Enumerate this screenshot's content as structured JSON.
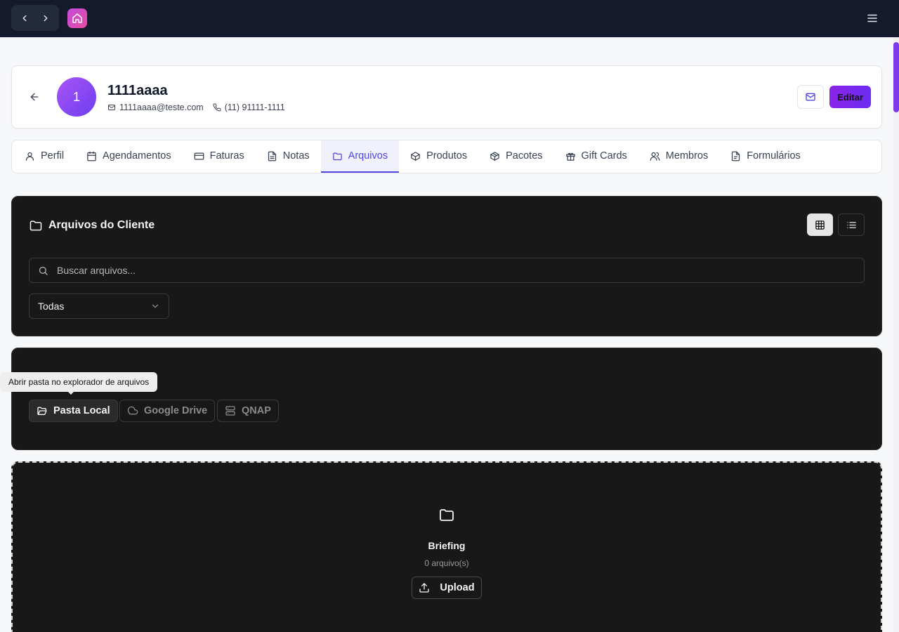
{
  "topbar": {
    "back_icon": "chevron-left-icon",
    "forward_icon": "chevron-right-icon",
    "logo_icon": "home-icon",
    "menu_icon": "hamburger-menu-icon"
  },
  "client": {
    "avatar_initial": "1",
    "name": "1111aaaa",
    "email": "1111aaaa@teste.com",
    "phone": "(11) 91111-1111",
    "edit_label": "Editar"
  },
  "tabs": [
    {
      "label": "Perfil",
      "icon": "user-icon"
    },
    {
      "label": "Agendamentos",
      "icon": "calendar-icon"
    },
    {
      "label": "Faturas",
      "icon": "credit-card-icon"
    },
    {
      "label": "Notas",
      "icon": "file-text-icon"
    },
    {
      "label": "Arquivos",
      "icon": "folder-icon",
      "active": true
    },
    {
      "label": "Produtos",
      "icon": "box-icon"
    },
    {
      "label": "Pacotes",
      "icon": "package-icon"
    },
    {
      "label": "Gift Cards",
      "icon": "gift-icon"
    },
    {
      "label": "Membros",
      "icon": "users-icon"
    },
    {
      "label": "Formulários",
      "icon": "form-icon"
    }
  ],
  "files": {
    "title": "Arquivos do Cliente",
    "search_placeholder": "Buscar arquivos...",
    "filter_value": "Todas"
  },
  "sources": {
    "tooltip": "Abrir pasta no explorador de arquivos",
    "local": "Pasta Local",
    "gdrive": "Google Drive",
    "qnap": "QNAP"
  },
  "folder": {
    "name": "Briefing",
    "count": "0 arquivo(s)",
    "upload_label": "Upload"
  },
  "colors": {
    "accent": "#4f46e5",
    "topbar": "#141a2b",
    "panel": "#181818",
    "edit_button": "#7c2cf0"
  }
}
